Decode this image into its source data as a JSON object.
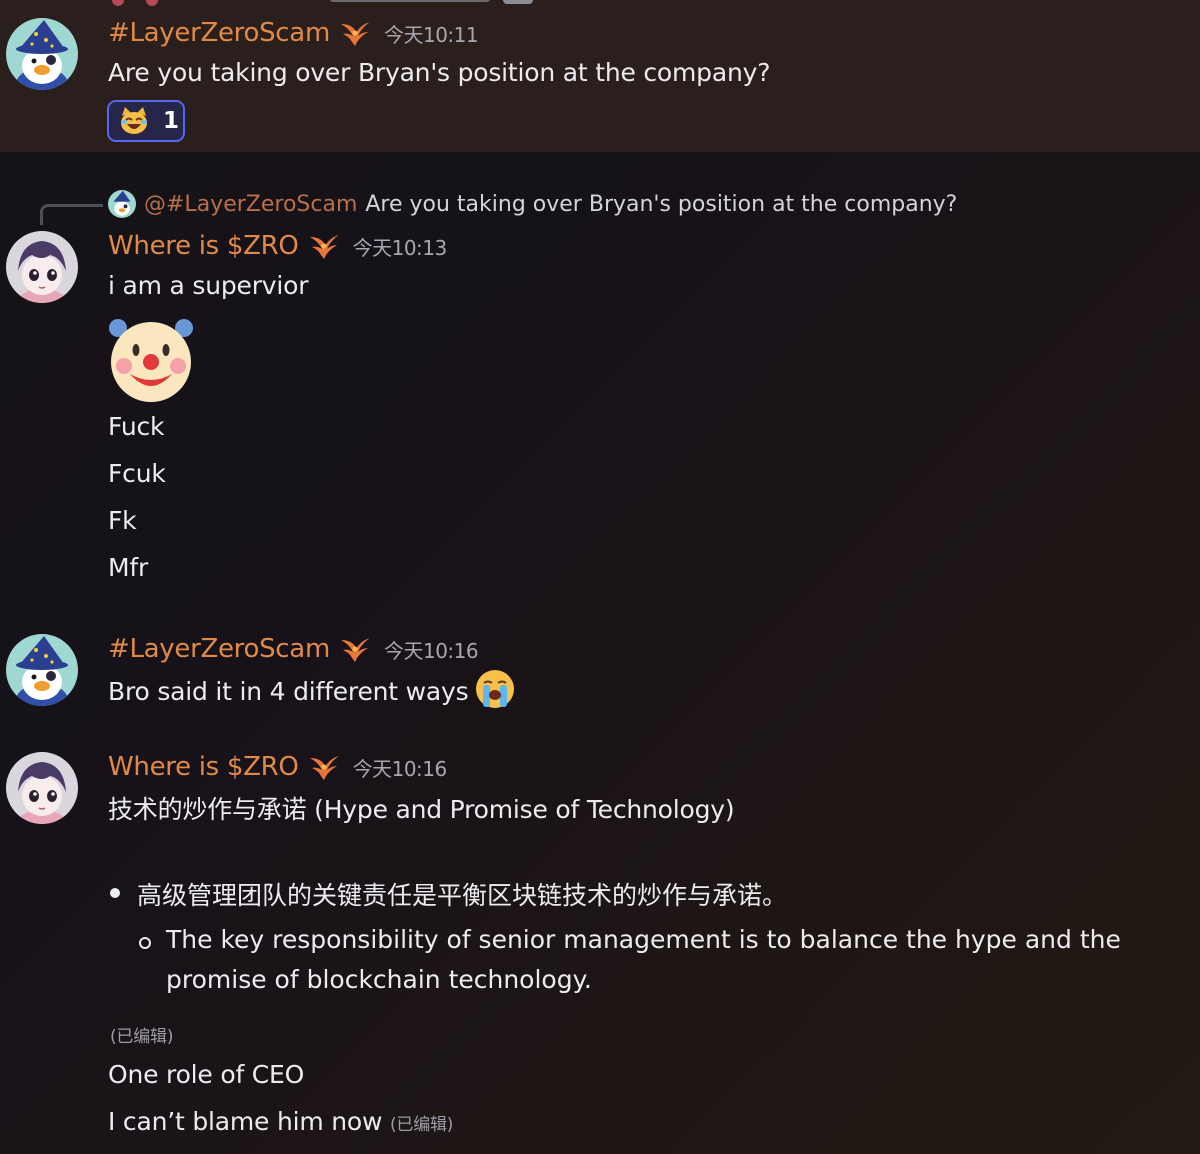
{
  "messages": [
    {
      "author": "#LayerZeroScam",
      "time": "今天10:11",
      "lines": [
        "Are you taking over Bryan's position at the company?"
      ],
      "reaction": {
        "emoji": "cat-laughing-emoji",
        "count": "1"
      }
    },
    {
      "reply_to": {
        "author": "@#LayerZeroScam",
        "text": "Are you taking over Bryan's position at the company?"
      },
      "author": "Where is $ZRO",
      "time": "今天10:13",
      "lines": [
        "i am a supervior",
        "Fuck",
        "Fcuk",
        "Fk",
        "Mfr"
      ],
      "emoji": "clown-emoji"
    },
    {
      "author": "#LayerZeroScam",
      "time": "今天10:16",
      "lines": [
        "Bro said it in 4 different ways"
      ],
      "emoji": "loudly-crying-emoji"
    },
    {
      "author": "Where is $ZRO",
      "time": "今天10:16",
      "heading": "技术的炒作与承诺 (Hype and Promise of Technology)",
      "bullet": "高级管理团队的关键责任是平衡区块链技术的炒作与承诺。",
      "sub_bullet_line1": "The key responsibility of senior management is to balance the hype and the",
      "sub_bullet_line2": "promise of blockchain technology.",
      "edited_label": "(已编辑)",
      "lines": [
        "One role of CEO",
        "I can’t blame him now"
      ]
    }
  ],
  "colors": {
    "username": "#e08a45",
    "reaction_border": "#5865f2",
    "highlight_band": "#2a1f1d"
  }
}
